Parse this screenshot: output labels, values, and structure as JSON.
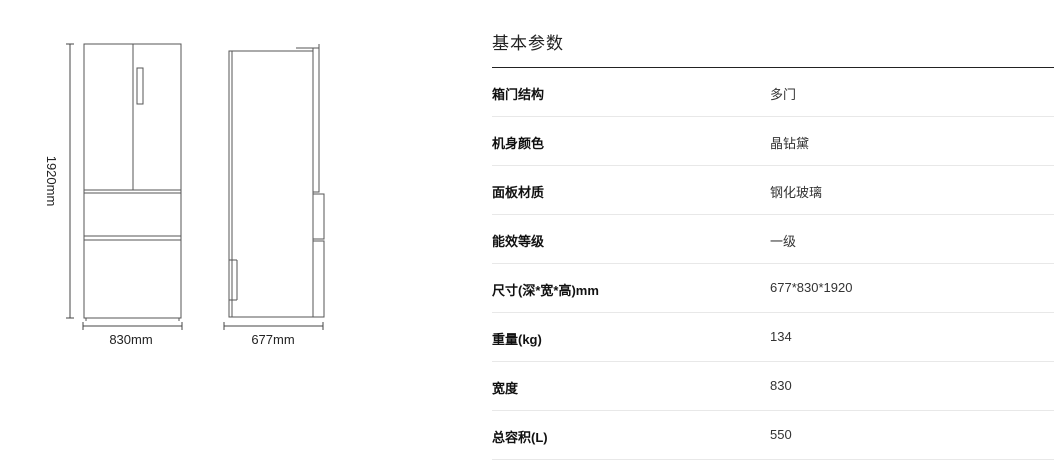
{
  "diagram": {
    "height_label": "1920mm",
    "front_width_label": "830mm",
    "side_depth_label": "677mm"
  },
  "specs": {
    "section_title": "基本参数",
    "rows": [
      {
        "label": "箱门结构",
        "value": "多门"
      },
      {
        "label": "机身颜色",
        "value": "晶钻黛"
      },
      {
        "label": "面板材质",
        "value": "钢化玻璃"
      },
      {
        "label": "能效等级",
        "value": "一级"
      },
      {
        "label": "尺寸(深*宽*高)mm",
        "value": "677*830*1920"
      },
      {
        "label": "重量(kg)",
        "value": "134"
      },
      {
        "label": "宽度",
        "value": "830"
      },
      {
        "label": "总容积(L)",
        "value": "550"
      }
    ]
  }
}
